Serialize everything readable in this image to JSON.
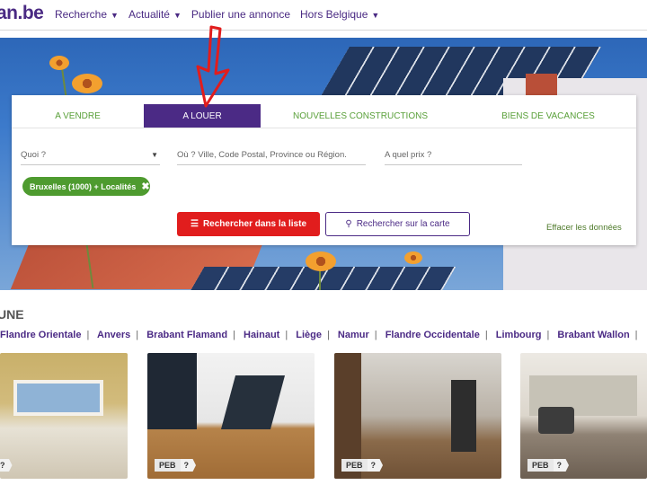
{
  "header": {
    "logo": "an.be",
    "nav": [
      {
        "label": "Recherche",
        "caret": "▼"
      },
      {
        "label": "Actualité",
        "caret": "▼"
      },
      {
        "label": "Publier une annonce",
        "caret": ""
      },
      {
        "label": "Hors Belgique",
        "caret": "▼"
      }
    ]
  },
  "search": {
    "tabs": [
      {
        "label": "A VENDRE",
        "active": false
      },
      {
        "label": "A LOUER",
        "active": true
      },
      {
        "label": "NOUVELLES CONSTRUCTIONS",
        "active": false
      },
      {
        "label": "BIENS DE VACANCES",
        "active": false
      }
    ],
    "what_placeholder": "Quoi ?",
    "where_placeholder": "Où ? Ville, Code Postal, Province ou Région.",
    "price_placeholder": "A quel prix ?",
    "chip_label": "Bruxelles (1000) + Localités",
    "btn_list_label": "Rechercher dans la liste",
    "btn_map_label": "Rechercher sur la carte",
    "clear_label": "Effacer les données"
  },
  "section": {
    "title": "UNE",
    "provinces": [
      "Flandre Orientale",
      "Anvers",
      "Brabant Flamand",
      "Hainaut",
      "Liège",
      "Namur",
      "Flandre Occidentale",
      "Limbourg",
      "Brabant Wallon"
    ],
    "peb_label": "PEB",
    "peb_value": "?"
  },
  "colors": {
    "brand": "#4b2a85",
    "accent_green": "#4e9b2f",
    "cta_red": "#e11d1d"
  }
}
